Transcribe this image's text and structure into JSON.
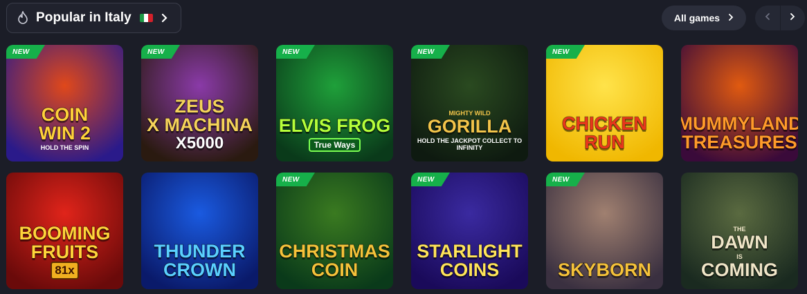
{
  "header": {
    "title": "Popular in Italy",
    "icon": "fire-icon",
    "flag": "italy-flag-icon",
    "chevron": "chevron-right-icon"
  },
  "controls": {
    "all_games_label": "All games",
    "prev_icon": "chevron-left-icon",
    "next_icon": "chevron-right-icon"
  },
  "badge_text": "NEW",
  "games": [
    {
      "new": true,
      "line1": "Coin",
      "line1b": "Win 2",
      "line3": "Hold the Spin",
      "bg": [
        "#2a1a8a",
        "#e0481a"
      ],
      "color": "#ffd23a"
    },
    {
      "new": true,
      "line1": "Zeus",
      "line1b": "x Machina",
      "line2": "x5000",
      "bg": [
        "#2a1a10",
        "#8a3aa8"
      ],
      "color": "#f5d35a"
    },
    {
      "new": true,
      "line1": "Elvis Frog",
      "pill": "True Ways",
      "bg": [
        "#0a3a1a",
        "#1fa03a"
      ],
      "color": "#b6ff3a"
    },
    {
      "new": true,
      "line3a": "Mighty Wild",
      "line1": "Gorilla",
      "line3": "Hold the Jackpot Collect to Infinity",
      "bg": [
        "#0e1a10",
        "#2a4a20"
      ],
      "color": "#f2c44a"
    },
    {
      "new": true,
      "line1": "Chicken",
      "line1b": "Run",
      "bg": [
        "#f0b700",
        "#ffe34a"
      ],
      "color": "#e8361c"
    },
    {
      "new": false,
      "line1": "Mummyland",
      "line1b": "Treasures",
      "bg": [
        "#3a0a3a",
        "#e05a10"
      ],
      "color": "#ff9a2a"
    },
    {
      "new": false,
      "line1": "Booming",
      "line1b": "Fruits",
      "mult": "81x",
      "bg": [
        "#6a0a0a",
        "#e0241a"
      ],
      "color": "#ffd43a"
    },
    {
      "new": false,
      "line1": "Thunder",
      "line1b": "Crown",
      "bg": [
        "#0a1a6a",
        "#1a5ae0"
      ],
      "color": "#5ad0ff"
    },
    {
      "new": true,
      "line1": "Christmas",
      "line1b": "Coin",
      "bg": [
        "#0a3a1a",
        "#3a7a20"
      ],
      "color": "#f5c23a"
    },
    {
      "new": true,
      "line1": "Starlight",
      "line1b": "Coins",
      "bg": [
        "#1a0a5a",
        "#3a2aa0"
      ],
      "color": "#ffe45a"
    },
    {
      "new": true,
      "line1": "Skyborn",
      "bg": [
        "#3a3040",
        "#a08070"
      ],
      "color": "#f5c23a"
    },
    {
      "new": false,
      "line3a": "The",
      "line1": "Dawn",
      "line3": "is",
      "line1b": "Coming",
      "bg": [
        "#1a2a20",
        "#5a6a40"
      ],
      "color": "#f0e6c8"
    }
  ]
}
